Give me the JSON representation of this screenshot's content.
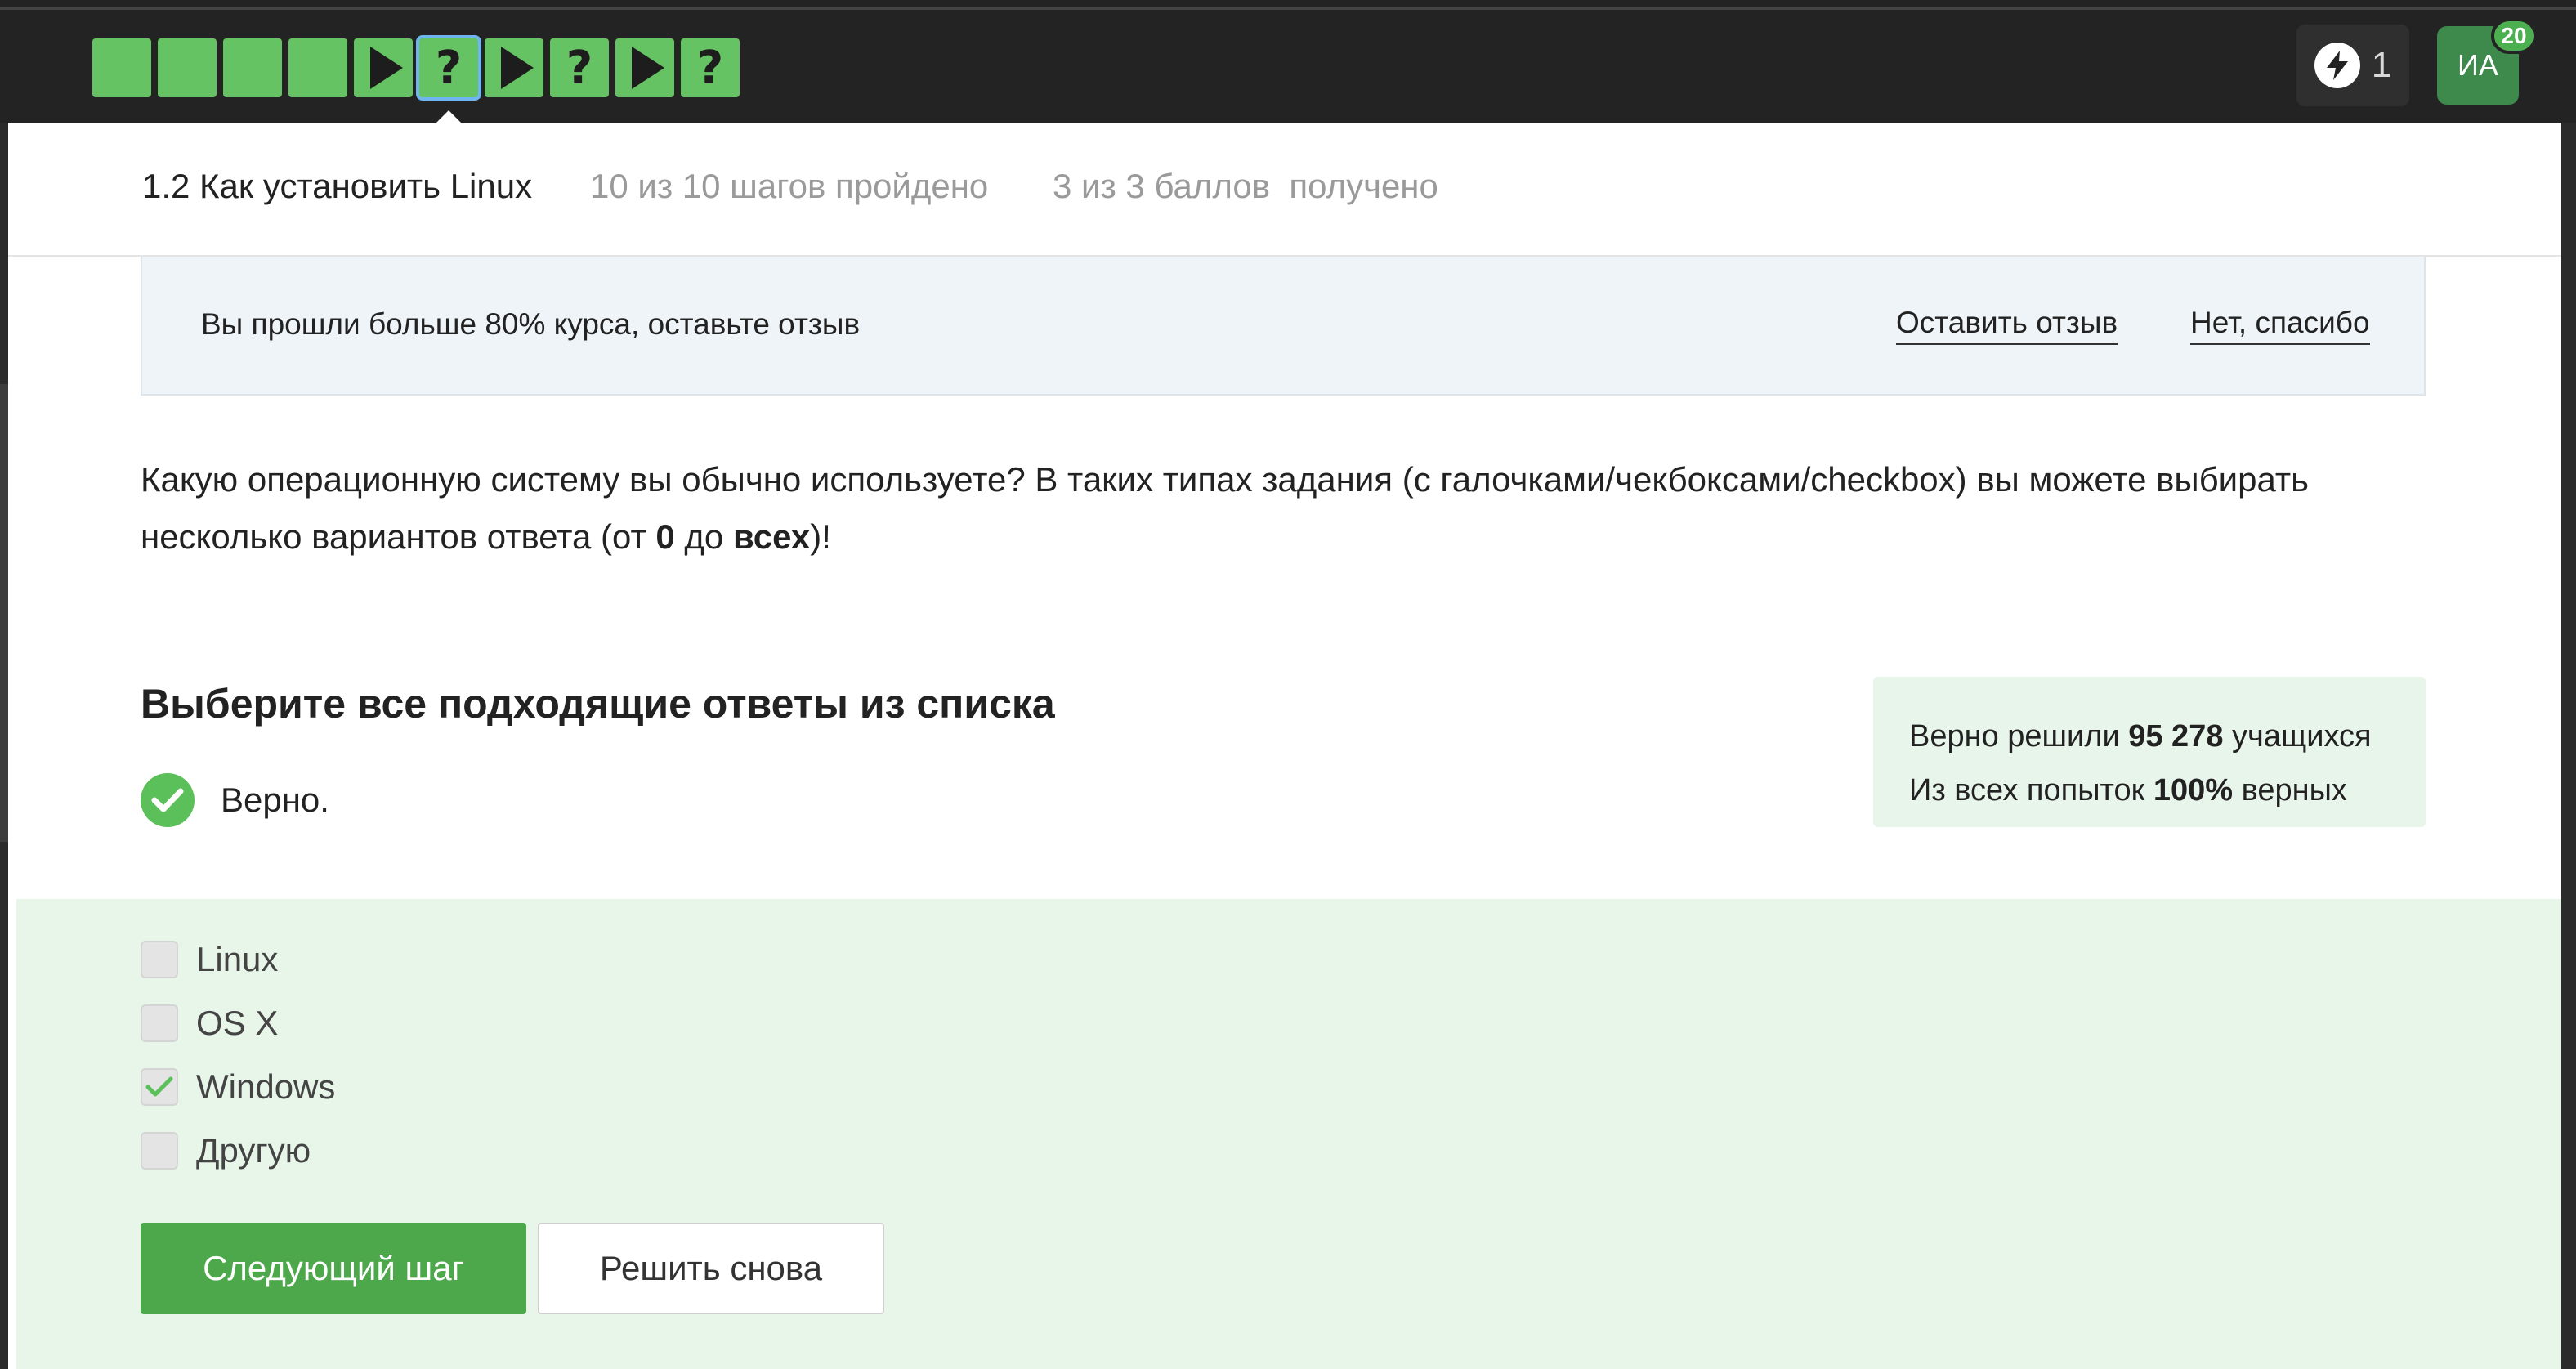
{
  "topbar": {
    "steps": [
      {
        "type": "done"
      },
      {
        "type": "done"
      },
      {
        "type": "done"
      },
      {
        "type": "done"
      },
      {
        "type": "video",
        "icon": "play-icon"
      },
      {
        "type": "quiz",
        "label": "?",
        "current": true
      },
      {
        "type": "video",
        "icon": "play-icon"
      },
      {
        "type": "quiz",
        "label": "?"
      },
      {
        "type": "video",
        "icon": "play-icon"
      },
      {
        "type": "quiz",
        "label": "?"
      }
    ],
    "energy": {
      "icon": "lightning-icon",
      "count": "1"
    },
    "avatar": {
      "initials": "ИА",
      "badge": "20"
    }
  },
  "lesson": {
    "title": "1.2 Как установить Linux",
    "steps_progress": "10 из 10 шагов пройдено",
    "score_progress": "3 из 3 баллов  получено"
  },
  "banner": {
    "text": "Вы прошли больше 80% курса, оставьте отзыв",
    "leave_review": "Оставить отзыв",
    "no_thanks": "Нет, спасибо"
  },
  "question": {
    "text_before_zero": "Какую операционную систему вы обычно используете? В таких типах задания (с галочками/чекбоксами/checkbox) вы можете выбирать несколько вариантов ответа (от ",
    "zero": "0",
    "middle": " до ",
    "all": "всех",
    "end": ")!"
  },
  "quiz": {
    "title": "Выберите все подходящие ответы из списка",
    "verdict": "Верно.",
    "options": [
      {
        "label": "Linux",
        "checked": false
      },
      {
        "label": "OS X",
        "checked": false
      },
      {
        "label": "Windows",
        "checked": true
      },
      {
        "label": "Другую",
        "checked": false
      }
    ],
    "next_button": "Следующий шаг",
    "retry_button": "Решить снова"
  },
  "stats": {
    "line1_prefix": "Верно решили ",
    "line1_value": "95 278",
    "line1_suffix": " учащихся",
    "line2_prefix": "Из всех попыток ",
    "line2_value": "100%",
    "line2_suffix": " верных"
  },
  "colors": {
    "accent_green": "#66c364",
    "button_green": "#4ca84a",
    "answers_bg": "#e8f6ea",
    "topbar_bg": "#232323"
  }
}
